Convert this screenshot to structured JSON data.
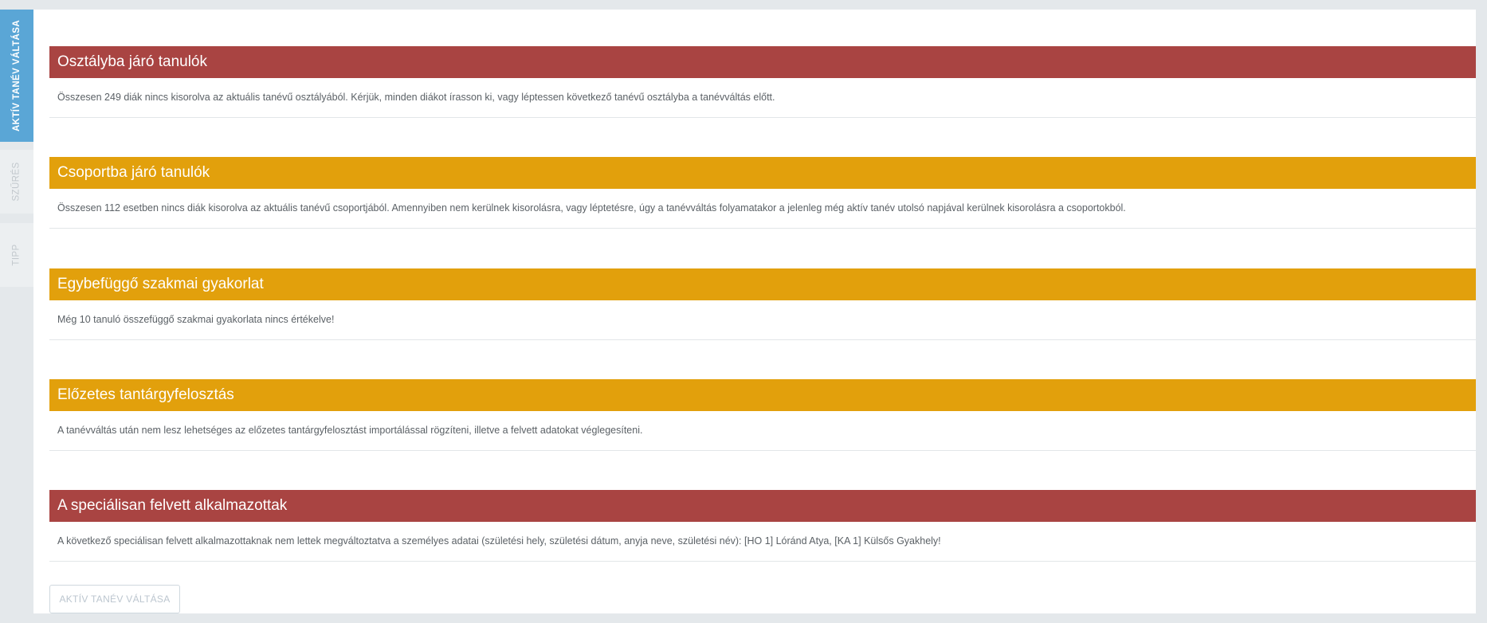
{
  "sidebar": {
    "tabs": [
      {
        "label": "AKTÍV TANÉV VÁLTÁSA"
      },
      {
        "label": "SZŰRÉS"
      },
      {
        "label": "TIPP"
      }
    ]
  },
  "colors": {
    "danger": "#a94442",
    "warning": "#e2a00c",
    "accent": "#5aa6d6"
  },
  "panels": [
    {
      "title": "Osztályba járó tanulók",
      "text": "Összesen 249 diák nincs kisorolva az aktuális tanévű osztályából. Kérjük, minden diákot írasson ki, vagy léptessen következő tanévű osztályba a tanévváltás előtt.",
      "status": "danger"
    },
    {
      "title": "Csoportba járó tanulók",
      "text": "Összesen 112 esetben nincs diák kisorolva az aktuális tanévű csoportjából. Amennyiben nem kerülnek kisorolásra, vagy léptetésre, úgy a tanévváltás folyamatakor a jelenleg még aktív tanév utolsó napjával kerülnek kisorolásra a csoportokból.",
      "status": "warning"
    },
    {
      "title": "Egybefüggő szakmai gyakorlat",
      "text": "Még 10 tanuló összefüggő szakmai gyakorlata nincs értékelve!",
      "status": "warning"
    },
    {
      "title": "Előzetes tantárgyfelosztás",
      "text": "A tanévváltás után nem lesz lehetséges az előzetes tantárgyfelosztást importálással rögzíteni, illetve a felvett adatokat véglegesíteni.",
      "status": "warning"
    },
    {
      "title": "A speciálisan felvett alkalmazottak",
      "text": "A következő speciálisan felvett alkalmazottaknak nem lettek megváltoztatva a személyes adatai (születési hely, születési dátum, anyja neve, születési név): [HO 1] Lóránd Atya, [KA 1] Külsős Gyakhely!",
      "status": "danger"
    }
  ],
  "actions": {
    "submit_label": "AKTÍV TANÉV VÁLTÁSA"
  }
}
